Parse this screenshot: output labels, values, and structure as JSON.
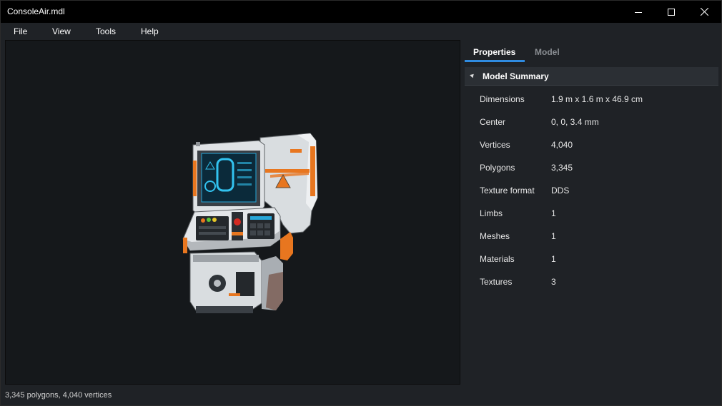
{
  "window": {
    "title": "ConsoleAir.mdl",
    "controls": [
      "minimize",
      "maximize",
      "close"
    ]
  },
  "menu": {
    "items": [
      "File",
      "View",
      "Tools",
      "Help"
    ]
  },
  "panel": {
    "tabs": [
      {
        "label": "Properties",
        "active": true
      },
      {
        "label": "Model",
        "active": false
      }
    ],
    "section": {
      "title": "Model Summary",
      "rows": [
        {
          "label": "Dimensions",
          "value": "1.9 m x 1.6 m x 46.9 cm"
        },
        {
          "label": "Center",
          "value": "0, 0, 3.4 mm"
        },
        {
          "label": "Vertices",
          "value": "4,040"
        },
        {
          "label": "Polygons",
          "value": "3,345"
        },
        {
          "label": "Texture format",
          "value": "DDS"
        },
        {
          "label": "Limbs",
          "value": "1"
        },
        {
          "label": "Meshes",
          "value": "1"
        },
        {
          "label": "Materials",
          "value": "1"
        },
        {
          "label": "Textures",
          "value": "3"
        }
      ]
    }
  },
  "status": {
    "text": "3,345 polygons, 4,040 vertices"
  },
  "colors": {
    "accent": "#2f8be0",
    "background": "#1f2226",
    "viewport": "#15181b",
    "model_orange": "#e8761f"
  },
  "icons": {
    "minimize": "minimize-icon",
    "maximize": "maximize-icon",
    "close": "close-icon",
    "collapse": "collapse-arrow-icon",
    "warning": "warning-icon"
  }
}
